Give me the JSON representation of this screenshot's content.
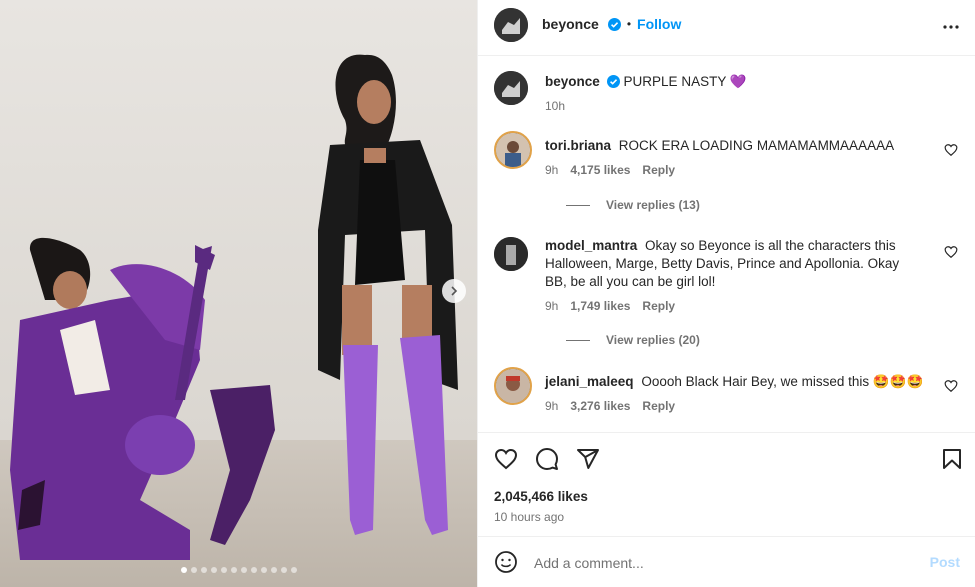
{
  "post_author": {
    "username": "beyonce",
    "follow_label": "Follow",
    "separator": "•"
  },
  "caption": {
    "username": "beyonce",
    "text": "PURPLE NASTY",
    "emoji": "💜",
    "time": "10h"
  },
  "comments": [
    {
      "username": "tori.briana",
      "text": "ROCK ERA LOADING MAMAMAMMAAAAAA",
      "time": "9h",
      "likes": "4,175 likes",
      "reply_label": "Reply",
      "view_replies": "View replies (13)"
    },
    {
      "username": "model_mantra",
      "text": "Okay so Beyonce is all the characters this Halloween, Marge, Betty Davis, Prince and Apollonia. Okay BB, be all you can be girl lol!",
      "time": "9h",
      "likes": "1,749 likes",
      "reply_label": "Reply",
      "view_replies": "View replies (20)"
    },
    {
      "username": "jelani_maleeq",
      "text": "Ooooh Black Hair Bey, we missed this 🤩🤩🤩",
      "time": "9h",
      "likes": "3,276 likes",
      "reply_label": "Reply"
    }
  ],
  "stats": {
    "likes": "2,045,466 likes",
    "posted": "10 hours ago"
  },
  "composer": {
    "placeholder": "Add a comment...",
    "post_label": "Post"
  },
  "carousel": {
    "slide_count": 12,
    "active_index": 0
  },
  "colors": {
    "accent": "#0095f6",
    "muted": "#737373",
    "purple": "#7b3fb0"
  },
  "icons": [
    "more-icon",
    "verified-icon",
    "heart-icon",
    "comment-icon",
    "share-icon",
    "bookmark-icon",
    "emoji-icon",
    "chevron-right-icon"
  ]
}
